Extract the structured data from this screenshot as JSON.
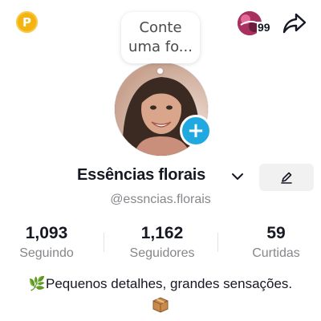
{
  "header": {
    "coin_letter": "P",
    "story_count": "99",
    "share_icon": "share-arrow-icon"
  },
  "bubble": {
    "text": "Conte uma fo..."
  },
  "profile": {
    "display_name": "Essências florais",
    "username": "@essncias.florais",
    "add_icon": "+",
    "accent_color": "#20a8e0",
    "coin_color": "#f4b30e"
  },
  "stats": [
    {
      "value": "1,093",
      "label": "Seguindo"
    },
    {
      "value": "1,162",
      "label": "Seguidores"
    },
    {
      "value": "59",
      "label": "Curtidas"
    }
  ],
  "bio": {
    "line1": "🌿Pequenos detalhes, grandes sensações.",
    "box_icon": "package-box-icon"
  }
}
